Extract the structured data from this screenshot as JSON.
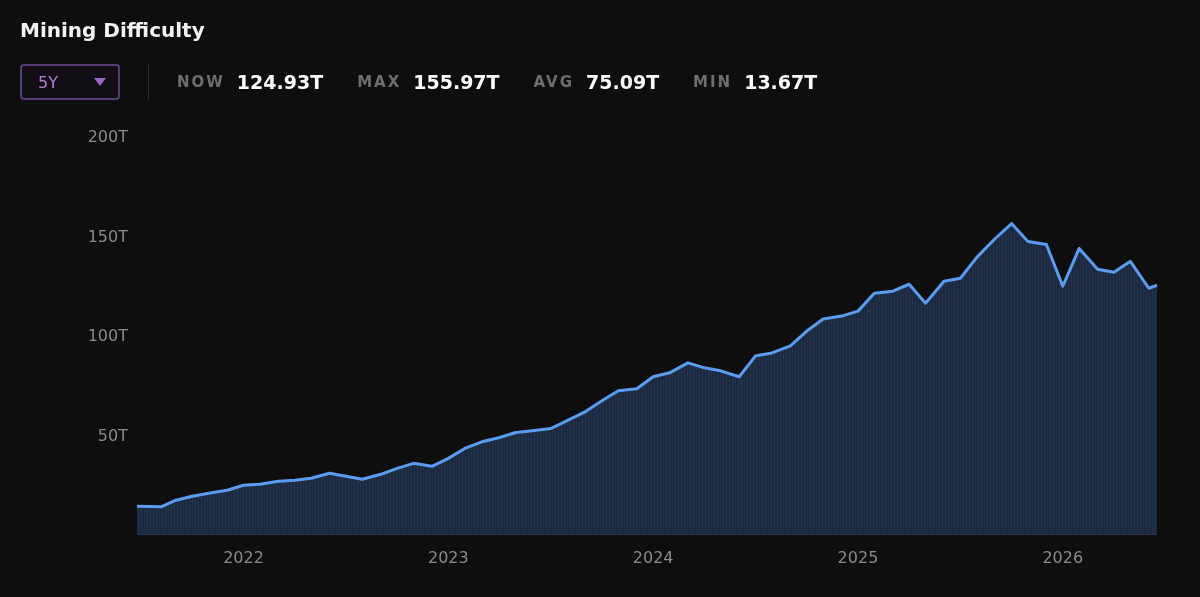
{
  "title": "Mining Difficulty",
  "range_selector": {
    "value": "5Y"
  },
  "stats": [
    {
      "label": "NOW",
      "value": "124.93T"
    },
    {
      "label": "MAX",
      "value": "155.97T"
    },
    {
      "label": "AVG",
      "value": "75.09T"
    },
    {
      "label": "MIN",
      "value": "13.67T"
    }
  ],
  "chart_data": {
    "type": "area",
    "x": [
      2021.48,
      2021.6,
      2021.67,
      2021.75,
      2021.83,
      2021.92,
      2022.0,
      2022.08,
      2022.17,
      2022.25,
      2022.33,
      2022.42,
      2022.5,
      2022.58,
      2022.67,
      2022.75,
      2022.83,
      2022.92,
      2023.0,
      2023.08,
      2023.17,
      2023.25,
      2023.33,
      2023.42,
      2023.5,
      2023.58,
      2023.67,
      2023.75,
      2023.83,
      2023.92,
      2024.0,
      2024.08,
      2024.17,
      2024.25,
      2024.33,
      2024.42,
      2024.5,
      2024.58,
      2024.67,
      2024.75,
      2024.83,
      2024.92,
      2025.0,
      2025.08,
      2025.17,
      2025.25,
      2025.33,
      2025.42,
      2025.5,
      2025.58,
      2025.67,
      2025.75,
      2025.83,
      2025.92,
      2026.0,
      2026.08,
      2026.17,
      2026.25,
      2026.33,
      2026.42,
      2026.46
    ],
    "series": [
      {
        "color": "#5b9cf0",
        "values": [
          14,
          13.7,
          17,
          19,
          20.5,
          22,
          24.5,
          25,
          26.5,
          27,
          28,
          30.5,
          29,
          27.5,
          30,
          33,
          35.5,
          34,
          38,
          43,
          46.5,
          48.5,
          51,
          52,
          53,
          57,
          61.5,
          67,
          72,
          73,
          79,
          81,
          86,
          83.5,
          82,
          79,
          89.5,
          91,
          94.5,
          102,
          108,
          109.5,
          112,
          121,
          122,
          125.5,
          116,
          127,
          128.5,
          139,
          148.5,
          156,
          147,
          145.5,
          124.5,
          143.5,
          133,
          131.5,
          137,
          123.5,
          125
        ]
      }
    ],
    "xlim": [
      2021.48,
      2026.46
    ],
    "ylim": [
      0,
      200
    ],
    "xticks": [
      {
        "value": 2022,
        "label": "2022"
      },
      {
        "value": 2023,
        "label": "2023"
      },
      {
        "value": 2024,
        "label": "2024"
      },
      {
        "value": 2025,
        "label": "2025"
      },
      {
        "value": 2026,
        "label": "2026"
      }
    ],
    "yticks": [
      {
        "value": 50,
        "label": "50T"
      },
      {
        "value": 100,
        "label": "100T"
      },
      {
        "value": 150,
        "label": "150T"
      },
      {
        "value": 200,
        "label": "200T"
      }
    ]
  }
}
